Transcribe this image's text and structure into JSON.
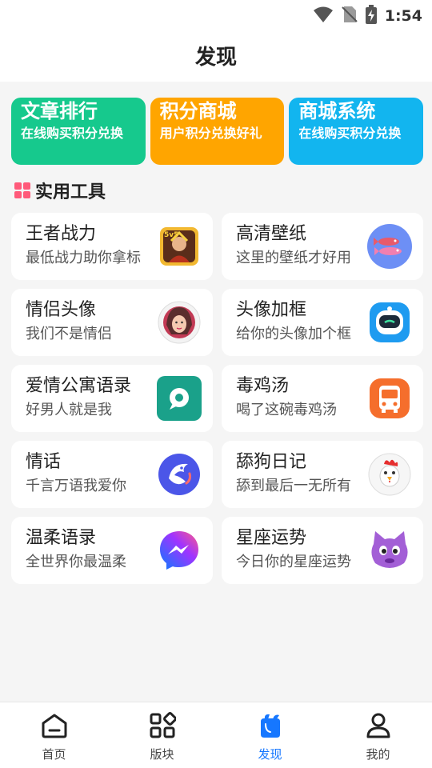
{
  "status": {
    "time": "1:54"
  },
  "header": {
    "title": "发现"
  },
  "banners": [
    {
      "title": "文章排行",
      "subtitle": "在线购买积分兑换",
      "color": "#16c98d"
    },
    {
      "title": "积分商城",
      "subtitle": "用户积分兑换好礼",
      "color": "#ffa500"
    },
    {
      "title": "商城系统",
      "subtitle": "在线购买积分兑换",
      "color": "#12b5ef"
    }
  ],
  "section": {
    "title": "实用工具"
  },
  "tools": [
    {
      "title": "王者战力",
      "subtitle": "最低战力助你拿标",
      "icon": "game-hero-icon"
    },
    {
      "title": "高清壁纸",
      "subtitle": "这里的壁纸才好用",
      "icon": "wallpaper-icon"
    },
    {
      "title": "情侣头像",
      "subtitle": "我们不是情侣",
      "icon": "avatar-girl-icon"
    },
    {
      "title": "头像加框",
      "subtitle": "给你的头像加个框",
      "icon": "robot-icon"
    },
    {
      "title": "爱情公寓语录",
      "subtitle": "好男人就是我",
      "icon": "chat-bubble-icon"
    },
    {
      "title": "毒鸡汤",
      "subtitle": "喝了这碗毒鸡汤",
      "icon": "bus-icon"
    },
    {
      "title": "情话",
      "subtitle": "千言万语我爱你",
      "icon": "dolphin-icon"
    },
    {
      "title": "舔狗日记",
      "subtitle": "舔到最后一无所有",
      "icon": "rooster-icon"
    },
    {
      "title": "温柔语录",
      "subtitle": "全世界你最温柔",
      "icon": "messenger-icon"
    },
    {
      "title": "星座运势",
      "subtitle": "今日你的星座运势",
      "icon": "cat-monster-icon"
    }
  ],
  "tabs": [
    {
      "label": "首页",
      "icon": "home-icon"
    },
    {
      "label": "版块",
      "icon": "blocks-icon"
    },
    {
      "label": "发现",
      "icon": "discover-icon",
      "active": true
    },
    {
      "label": "我的",
      "icon": "profile-icon"
    }
  ],
  "colors": {
    "accent": "#1677ff",
    "section_icon": "#ff5a7a"
  }
}
